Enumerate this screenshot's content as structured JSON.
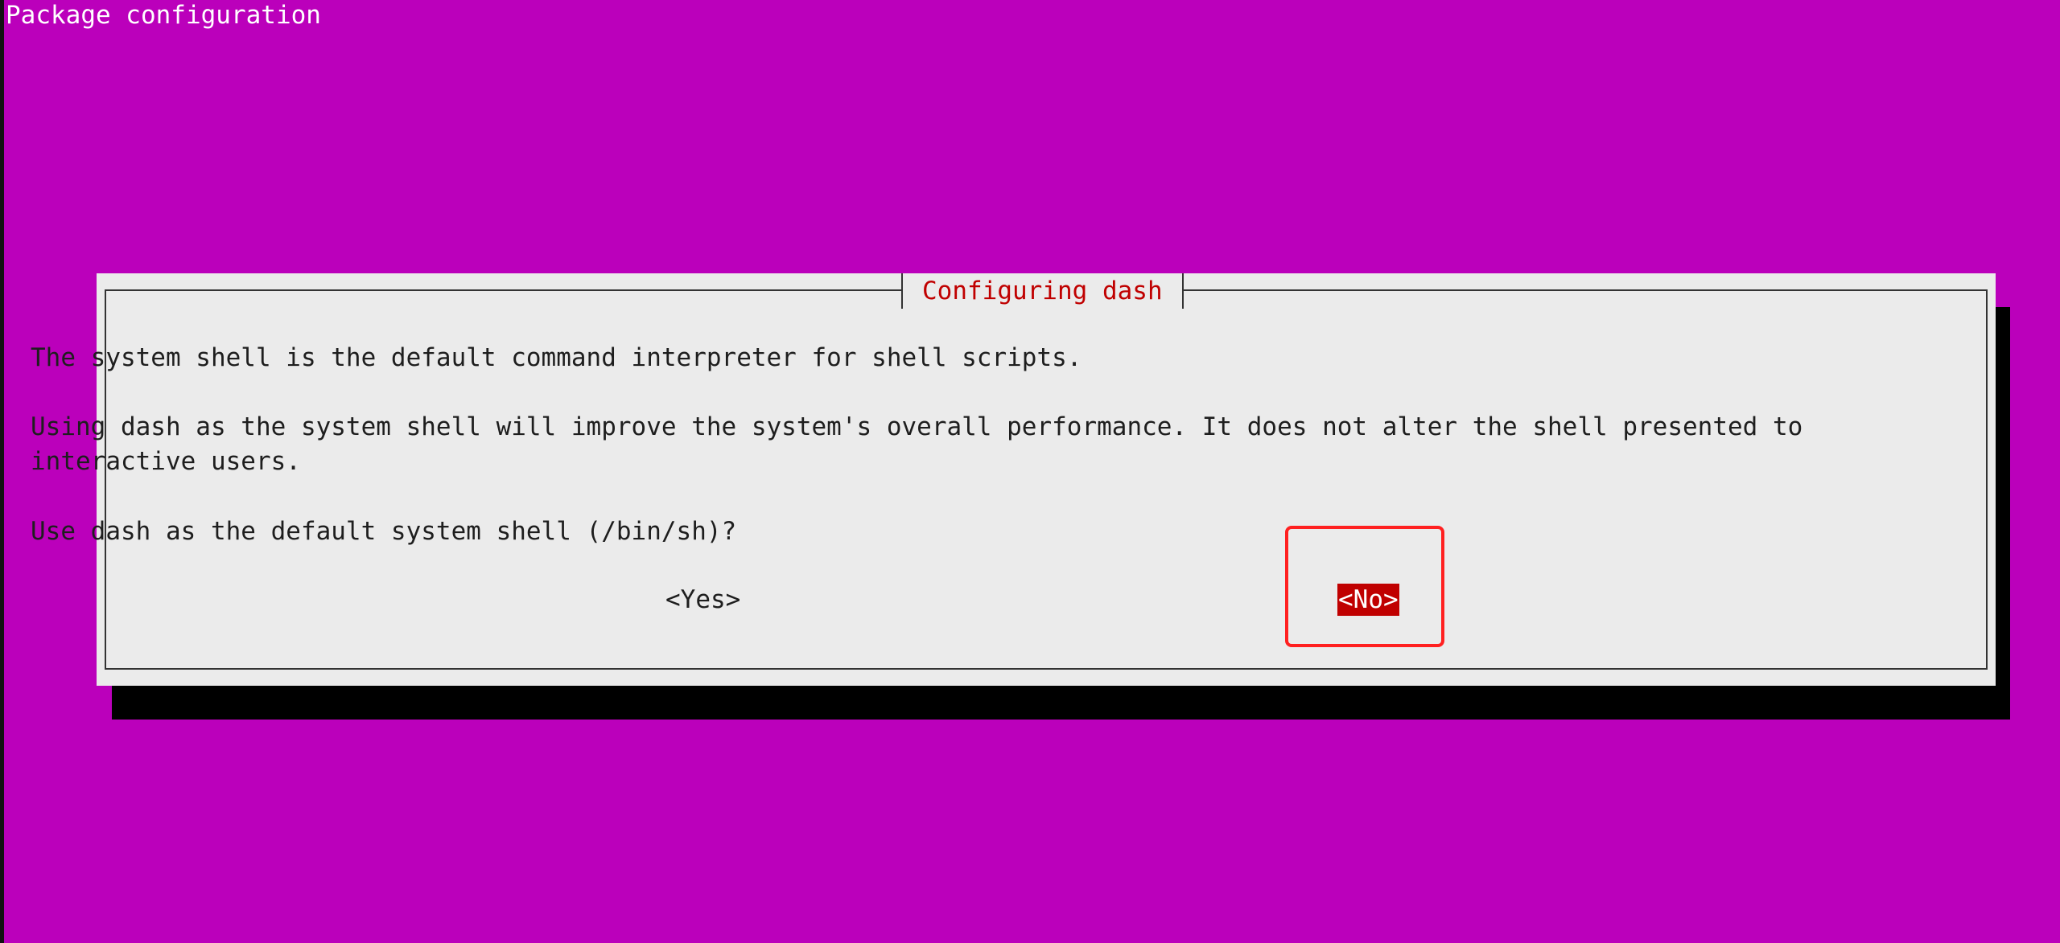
{
  "header": {
    "title": "Package configuration"
  },
  "dialog": {
    "title": "Configuring dash",
    "lines": [
      "The system shell is the default command interpreter for shell scripts.",
      "Using dash as the system shell will improve the system's overall performance. It does not alter the shell presented to",
      "interactive users.",
      "Use dash as the default system shell (/bin/sh)?"
    ],
    "buttons": {
      "yes_label": "<Yes>",
      "no_label": "<No>",
      "selected": "no"
    }
  },
  "colors": {
    "background": "#bb00bb",
    "dialog_bg": "#ebebeb",
    "shadow": "#000000",
    "accent": "#c00000",
    "highlight_box": "#ff2020"
  }
}
